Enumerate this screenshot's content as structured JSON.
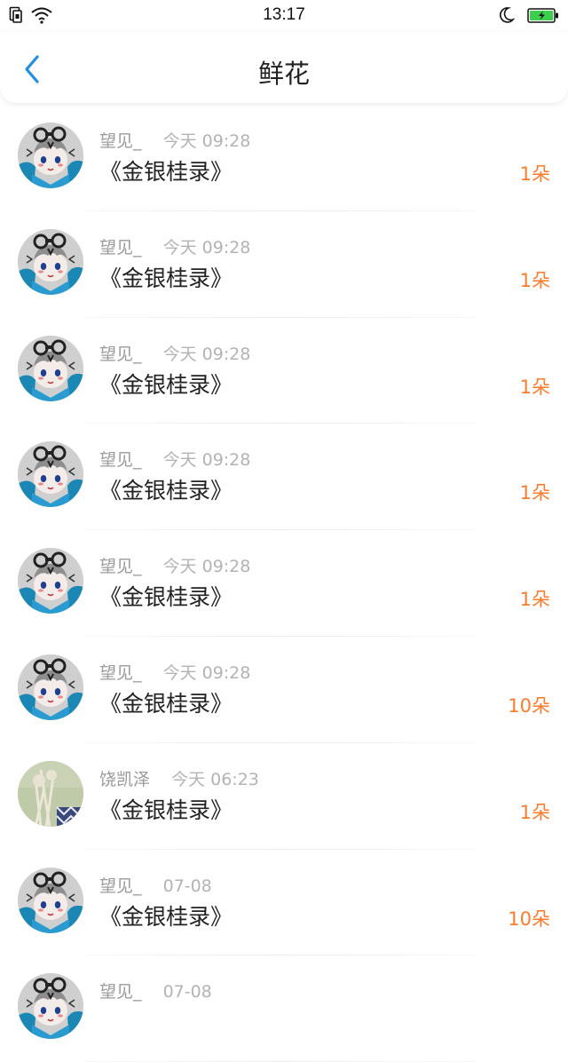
{
  "status_bar": {
    "time": "13:17"
  },
  "header": {
    "title": "鲜花"
  },
  "colors": {
    "accent_blue": "#1e8fe1",
    "count_orange": "#ff7b2c",
    "battery_green": "#3ccf4e"
  },
  "items": [
    {
      "name": "望见_",
      "time": "今天 09:28",
      "book": "《金银桂录》",
      "count": "1朵",
      "avatar": "anime-avatar"
    },
    {
      "name": "望见_",
      "time": "今天 09:28",
      "book": "《金银桂录》",
      "count": "1朵",
      "avatar": "anime-avatar"
    },
    {
      "name": "望见_",
      "time": "今天 09:28",
      "book": "《金银桂录》",
      "count": "1朵",
      "avatar": "anime-avatar"
    },
    {
      "name": "望见_",
      "time": "今天 09:28",
      "book": "《金银桂录》",
      "count": "1朵",
      "avatar": "anime-avatar"
    },
    {
      "name": "望见_",
      "time": "今天 09:28",
      "book": "《金银桂录》",
      "count": "1朵",
      "avatar": "anime-avatar"
    },
    {
      "name": "望见_",
      "time": "今天 09:28",
      "book": "《金银桂录》",
      "count": "10朵",
      "avatar": "anime-avatar"
    },
    {
      "name": "饶凯泽",
      "time": "今天 06:23",
      "book": "《金银桂录》",
      "count": "1朵",
      "avatar": "photo-avatar"
    },
    {
      "name": "望见_",
      "time": "07-08",
      "book": "《金银桂录》",
      "count": "10朵",
      "avatar": "anime-avatar"
    },
    {
      "name": "望见_",
      "time": "07-08",
      "book": "",
      "count": "",
      "avatar": "anime-avatar"
    }
  ]
}
